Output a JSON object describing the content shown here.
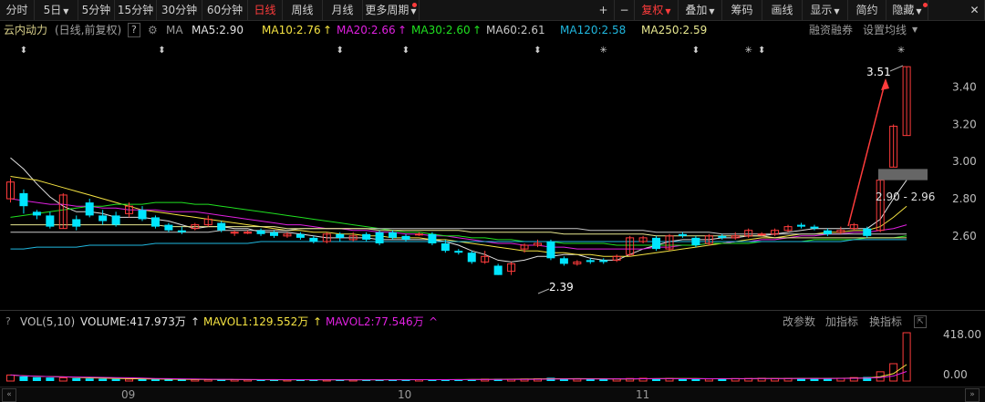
{
  "toolbar": {
    "tabs": [
      {
        "label": "分时"
      },
      {
        "label": "5日",
        "caret": "▼"
      },
      {
        "label": "5分钟"
      },
      {
        "label": "15分钟"
      },
      {
        "label": "30分钟"
      },
      {
        "label": "60分钟"
      },
      {
        "label": "日线",
        "active": true
      },
      {
        "label": "周线"
      },
      {
        "label": "月线"
      },
      {
        "label": "更多周期",
        "caret": "▼"
      }
    ],
    "right": [
      {
        "label": "+"
      },
      {
        "label": "−"
      },
      {
        "label": "复权",
        "caret": "▼",
        "red": true
      },
      {
        "label": "叠加",
        "caret": "▼"
      },
      {
        "label": "筹码"
      },
      {
        "label": "画线"
      },
      {
        "label": "显示",
        "caret": "▼"
      },
      {
        "label": "简约"
      },
      {
        "label": "隐藏",
        "caret": "▼"
      }
    ],
    "close_icon": "close-icon"
  },
  "indicator_line": {
    "stock": "云内动力",
    "mode": "(日线,前复权)",
    "help": "?",
    "ma_label": "MA",
    "ma5": "MA5:2.90",
    "ma10": "MA10:2.76",
    "ma20": "MA20:2.66",
    "ma30": "MA30:2.60",
    "ma60": "MA60:2.61",
    "ma120": "MA120:2.58",
    "ma250": "MA250:2.59",
    "up_arrow": "↑",
    "rzrq": "融资融券",
    "settings": "设置均线",
    "settings_caret": "▼"
  },
  "volume_line": {
    "help": "?",
    "label": "VOL(5,10)",
    "volume": "VOLUME:417.973万",
    "mavol1": "MAVOL1:129.552万",
    "mavol2": "MAVOL2:77.546万",
    "up_arrow": "↑",
    "caret": "^",
    "change_params": "改参数",
    "add_indicator": "加指标",
    "switch_indicator": "换指标"
  },
  "colors": {
    "up": "#ff3c3c",
    "down": "#00e5ff",
    "ma5": "#e0e0e0",
    "ma10": "#f5e342",
    "ma20": "#e020e0",
    "ma30": "#20e020",
    "ma60": "#c8c8c8",
    "ma120": "#20b8e0",
    "ma250": "#e8e890"
  },
  "event_markers": [
    "⬍",
    "⬍",
    "⬍",
    "⬍",
    "⬍",
    "✳",
    "⬍",
    "✳",
    "⬍",
    "✳"
  ],
  "chart_data": {
    "type": "candlestick",
    "ylim": [
      2.31,
      3.55
    ],
    "y_ticks": [
      "3.40",
      "3.20",
      "3.00",
      "2.80",
      "2.60"
    ],
    "x_ticks": [
      "09",
      "10",
      "11"
    ],
    "candles": [
      {
        "o": 2.8,
        "c": 2.89,
        "h": 2.91,
        "l": 2.78
      },
      {
        "o": 2.83,
        "c": 2.76,
        "h": 2.85,
        "l": 2.72
      },
      {
        "o": 2.73,
        "c": 2.71,
        "h": 2.74,
        "l": 2.69
      },
      {
        "o": 2.71,
        "c": 2.65,
        "h": 2.73,
        "l": 2.64
      },
      {
        "o": 2.64,
        "c": 2.82,
        "h": 2.83,
        "l": 2.64
      },
      {
        "o": 2.69,
        "c": 2.65,
        "h": 2.71,
        "l": 2.63
      },
      {
        "o": 2.78,
        "c": 2.71,
        "h": 2.8,
        "l": 2.7
      },
      {
        "o": 2.71,
        "c": 2.68,
        "h": 2.74,
        "l": 2.66
      },
      {
        "o": 2.71,
        "c": 2.66,
        "h": 2.73,
        "l": 2.65
      },
      {
        "o": 2.72,
        "c": 2.76,
        "h": 2.78,
        "l": 2.7
      },
      {
        "o": 2.74,
        "c": 2.69,
        "h": 2.76,
        "l": 2.68
      },
      {
        "o": 2.7,
        "c": 2.65,
        "h": 2.71,
        "l": 2.64
      },
      {
        "o": 2.66,
        "c": 2.63,
        "h": 2.67,
        "l": 2.62
      },
      {
        "o": 2.63,
        "c": 2.62,
        "h": 2.65,
        "l": 2.61
      },
      {
        "o": 2.64,
        "c": 2.66,
        "h": 2.67,
        "l": 2.63
      },
      {
        "o": 2.66,
        "c": 2.69,
        "h": 2.71,
        "l": 2.65
      },
      {
        "o": 2.67,
        "c": 2.63,
        "h": 2.68,
        "l": 2.62
      },
      {
        "o": 2.62,
        "c": 2.62,
        "h": 2.63,
        "l": 2.6
      },
      {
        "o": 2.62,
        "c": 2.62,
        "h": 2.63,
        "l": 2.61
      },
      {
        "o": 2.63,
        "c": 2.61,
        "h": 2.64,
        "l": 2.6
      },
      {
        "o": 2.62,
        "c": 2.6,
        "h": 2.63,
        "l": 2.59
      },
      {
        "o": 2.6,
        "c": 2.61,
        "h": 2.62,
        "l": 2.59
      },
      {
        "o": 2.61,
        "c": 2.59,
        "h": 2.62,
        "l": 2.58
      },
      {
        "o": 2.59,
        "c": 2.57,
        "h": 2.6,
        "l": 2.56
      },
      {
        "o": 2.57,
        "c": 2.61,
        "h": 2.62,
        "l": 2.56
      },
      {
        "o": 2.61,
        "c": 2.59,
        "h": 2.62,
        "l": 2.57
      },
      {
        "o": 2.58,
        "c": 2.6,
        "h": 2.62,
        "l": 2.57
      },
      {
        "o": 2.61,
        "c": 2.58,
        "h": 2.62,
        "l": 2.57
      },
      {
        "o": 2.62,
        "c": 2.56,
        "h": 2.63,
        "l": 2.55
      },
      {
        "o": 2.62,
        "c": 2.59,
        "h": 2.63,
        "l": 2.58
      },
      {
        "o": 2.6,
        "c": 2.58,
        "h": 2.61,
        "l": 2.57
      },
      {
        "o": 2.61,
        "c": 2.61,
        "h": 2.62,
        "l": 2.6
      },
      {
        "o": 2.61,
        "c": 2.56,
        "h": 2.62,
        "l": 2.55
      },
      {
        "o": 2.56,
        "c": 2.52,
        "h": 2.58,
        "l": 2.51
      },
      {
        "o": 2.52,
        "c": 2.51,
        "h": 2.53,
        "l": 2.5
      },
      {
        "o": 2.51,
        "c": 2.46,
        "h": 2.52,
        "l": 2.45
      },
      {
        "o": 2.46,
        "c": 2.49,
        "h": 2.52,
        "l": 2.45
      },
      {
        "o": 2.44,
        "c": 2.39,
        "h": 2.45,
        "l": 2.39
      },
      {
        "o": 2.41,
        "c": 2.45,
        "h": 2.46,
        "l": 2.39
      },
      {
        "o": 2.53,
        "c": 2.55,
        "h": 2.56,
        "l": 2.51
      },
      {
        "o": 2.55,
        "c": 2.56,
        "h": 2.58,
        "l": 2.54
      },
      {
        "o": 2.57,
        "c": 2.48,
        "h": 2.58,
        "l": 2.47
      },
      {
        "o": 2.48,
        "c": 2.45,
        "h": 2.49,
        "l": 2.44
      },
      {
        "o": 2.45,
        "c": 2.46,
        "h": 2.47,
        "l": 2.44
      },
      {
        "o": 2.47,
        "c": 2.46,
        "h": 2.48,
        "l": 2.45
      },
      {
        "o": 2.47,
        "c": 2.46,
        "h": 2.48,
        "l": 2.45
      },
      {
        "o": 2.47,
        "c": 2.49,
        "h": 2.5,
        "l": 2.46
      },
      {
        "o": 2.5,
        "c": 2.59,
        "h": 2.6,
        "l": 2.49
      },
      {
        "o": 2.57,
        "c": 2.59,
        "h": 2.6,
        "l": 2.56
      },
      {
        "o": 2.59,
        "c": 2.53,
        "h": 2.6,
        "l": 2.52
      },
      {
        "o": 2.53,
        "c": 2.6,
        "h": 2.61,
        "l": 2.52
      },
      {
        "o": 2.61,
        "c": 2.6,
        "h": 2.62,
        "l": 2.59
      },
      {
        "o": 2.59,
        "c": 2.55,
        "h": 2.6,
        "l": 2.54
      },
      {
        "o": 2.56,
        "c": 2.6,
        "h": 2.61,
        "l": 2.55
      },
      {
        "o": 2.6,
        "c": 2.59,
        "h": 2.61,
        "l": 2.58
      },
      {
        "o": 2.59,
        "c": 2.6,
        "h": 2.62,
        "l": 2.58
      },
      {
        "o": 2.6,
        "c": 2.63,
        "h": 2.64,
        "l": 2.59
      },
      {
        "o": 2.61,
        "c": 2.61,
        "h": 2.62,
        "l": 2.6
      },
      {
        "o": 2.61,
        "c": 2.63,
        "h": 2.64,
        "l": 2.6
      },
      {
        "o": 2.63,
        "c": 2.65,
        "h": 2.66,
        "l": 2.62
      },
      {
        "o": 2.66,
        "c": 2.65,
        "h": 2.67,
        "l": 2.64
      },
      {
        "o": 2.65,
        "c": 2.64,
        "h": 2.66,
        "l": 2.63
      },
      {
        "o": 2.63,
        "c": 2.61,
        "h": 2.64,
        "l": 2.6
      },
      {
        "o": 2.62,
        "c": 2.63,
        "h": 2.65,
        "l": 2.61
      },
      {
        "o": 2.64,
        "c": 2.66,
        "h": 2.67,
        "l": 2.63
      },
      {
        "o": 2.64,
        "c": 2.6,
        "h": 2.65,
        "l": 2.59
      },
      {
        "o": 2.63,
        "c": 2.9,
        "h": 2.9,
        "l": 2.62
      },
      {
        "o": 2.97,
        "c": 3.19,
        "h": 3.2,
        "l": 2.97
      },
      {
        "o": 3.14,
        "c": 3.51,
        "h": 3.51,
        "l": 3.14
      }
    ],
    "ma_series": [
      {
        "name": "MA5",
        "color_key": "ma5",
        "values": [
          3.02,
          2.96,
          2.88,
          2.81,
          2.76,
          2.73,
          2.73,
          2.72,
          2.7,
          2.7,
          2.7,
          2.69,
          2.68,
          2.66,
          2.64,
          2.65,
          2.65,
          2.64,
          2.64,
          2.62,
          2.62,
          2.62,
          2.61,
          2.6,
          2.59,
          2.59,
          2.59,
          2.59,
          2.58,
          2.58,
          2.58,
          2.58,
          2.58,
          2.57,
          2.55,
          2.52,
          2.5,
          2.47,
          2.46,
          2.47,
          2.49,
          2.49,
          2.5,
          2.5,
          2.48,
          2.47,
          2.47,
          2.5,
          2.53,
          2.55,
          2.57,
          2.58,
          2.58,
          2.58,
          2.59,
          2.59,
          2.6,
          2.6,
          2.61,
          2.62,
          2.63,
          2.64,
          2.64,
          2.64,
          2.64,
          2.64,
          2.69,
          2.8,
          2.9
        ]
      },
      {
        "name": "MA10",
        "color_key": "ma10",
        "values": [
          2.92,
          2.91,
          2.9,
          2.88,
          2.86,
          2.84,
          2.82,
          2.8,
          2.78,
          2.76,
          2.74,
          2.73,
          2.72,
          2.71,
          2.7,
          2.69,
          2.68,
          2.67,
          2.66,
          2.65,
          2.64,
          2.63,
          2.63,
          2.62,
          2.62,
          2.61,
          2.61,
          2.6,
          2.6,
          2.59,
          2.59,
          2.59,
          2.58,
          2.58,
          2.57,
          2.56,
          2.55,
          2.54,
          2.53,
          2.52,
          2.52,
          2.51,
          2.51,
          2.5,
          2.5,
          2.49,
          2.49,
          2.49,
          2.5,
          2.51,
          2.52,
          2.53,
          2.54,
          2.55,
          2.56,
          2.57,
          2.58,
          2.59,
          2.59,
          2.6,
          2.61,
          2.61,
          2.62,
          2.62,
          2.63,
          2.63,
          2.65,
          2.7,
          2.76
        ]
      },
      {
        "name": "MA20",
        "color_key": "ma20",
        "values": [
          2.8,
          2.79,
          2.78,
          2.77,
          2.77,
          2.76,
          2.76,
          2.75,
          2.75,
          2.74,
          2.74,
          2.74,
          2.73,
          2.73,
          2.73,
          2.72,
          2.71,
          2.7,
          2.69,
          2.68,
          2.67,
          2.66,
          2.66,
          2.65,
          2.64,
          2.64,
          2.63,
          2.63,
          2.62,
          2.62,
          2.61,
          2.61,
          2.6,
          2.6,
          2.59,
          2.58,
          2.57,
          2.56,
          2.56,
          2.55,
          2.55,
          2.54,
          2.54,
          2.53,
          2.53,
          2.53,
          2.53,
          2.53,
          2.53,
          2.54,
          2.54,
          2.55,
          2.55,
          2.56,
          2.56,
          2.57,
          2.57,
          2.58,
          2.58,
          2.59,
          2.6,
          2.6,
          2.61,
          2.61,
          2.62,
          2.62,
          2.63,
          2.64,
          2.66
        ]
      },
      {
        "name": "MA30",
        "color_key": "ma30",
        "values": [
          2.7,
          2.71,
          2.72,
          2.73,
          2.74,
          2.75,
          2.76,
          2.76,
          2.77,
          2.77,
          2.77,
          2.78,
          2.78,
          2.78,
          2.77,
          2.77,
          2.76,
          2.75,
          2.74,
          2.73,
          2.72,
          2.71,
          2.7,
          2.69,
          2.68,
          2.67,
          2.66,
          2.65,
          2.64,
          2.63,
          2.62,
          2.62,
          2.61,
          2.6,
          2.6,
          2.59,
          2.59,
          2.58,
          2.58,
          2.57,
          2.57,
          2.57,
          2.56,
          2.56,
          2.56,
          2.56,
          2.55,
          2.55,
          2.55,
          2.55,
          2.55,
          2.55,
          2.55,
          2.56,
          2.56,
          2.56,
          2.56,
          2.57,
          2.57,
          2.57,
          2.57,
          2.58,
          2.58,
          2.58,
          2.58,
          2.59,
          2.59,
          2.59,
          2.6
        ]
      },
      {
        "name": "MA60",
        "color_key": "ma60",
        "values": [
          2.62,
          2.62,
          2.62,
          2.62,
          2.62,
          2.62,
          2.62,
          2.62,
          2.62,
          2.62,
          2.62,
          2.62,
          2.62,
          2.62,
          2.62,
          2.62,
          2.63,
          2.63,
          2.63,
          2.63,
          2.63,
          2.63,
          2.64,
          2.64,
          2.64,
          2.64,
          2.64,
          2.64,
          2.64,
          2.64,
          2.64,
          2.64,
          2.64,
          2.64,
          2.64,
          2.64,
          2.64,
          2.64,
          2.64,
          2.64,
          2.64,
          2.64,
          2.64,
          2.64,
          2.63,
          2.63,
          2.63,
          2.63,
          2.63,
          2.62,
          2.62,
          2.62,
          2.62,
          2.62,
          2.61,
          2.61,
          2.61,
          2.61,
          2.61,
          2.61,
          2.61,
          2.61,
          2.61,
          2.61,
          2.61,
          2.61,
          2.61,
          2.61,
          2.61
        ]
      },
      {
        "name": "MA120",
        "color_key": "ma120",
        "values": [
          2.53,
          2.53,
          2.54,
          2.54,
          2.54,
          2.54,
          2.55,
          2.55,
          2.55,
          2.55,
          2.55,
          2.56,
          2.56,
          2.56,
          2.56,
          2.56,
          2.56,
          2.56,
          2.56,
          2.57,
          2.57,
          2.57,
          2.57,
          2.57,
          2.57,
          2.57,
          2.57,
          2.57,
          2.57,
          2.57,
          2.57,
          2.57,
          2.57,
          2.57,
          2.57,
          2.57,
          2.57,
          2.57,
          2.57,
          2.57,
          2.57,
          2.57,
          2.57,
          2.57,
          2.57,
          2.57,
          2.57,
          2.57,
          2.57,
          2.57,
          2.57,
          2.57,
          2.57,
          2.57,
          2.57,
          2.57,
          2.57,
          2.57,
          2.57,
          2.57,
          2.57,
          2.57,
          2.57,
          2.57,
          2.58,
          2.58,
          2.58,
          2.58,
          2.58
        ]
      },
      {
        "name": "MA250",
        "color_key": "ma250",
        "values": [
          2.66,
          2.66,
          2.66,
          2.66,
          2.66,
          2.66,
          2.66,
          2.66,
          2.66,
          2.66,
          2.66,
          2.66,
          2.65,
          2.65,
          2.65,
          2.65,
          2.65,
          2.65,
          2.65,
          2.65,
          2.65,
          2.64,
          2.64,
          2.64,
          2.64,
          2.64,
          2.64,
          2.64,
          2.63,
          2.63,
          2.63,
          2.63,
          2.63,
          2.63,
          2.63,
          2.62,
          2.62,
          2.62,
          2.62,
          2.62,
          2.62,
          2.62,
          2.61,
          2.61,
          2.61,
          2.61,
          2.61,
          2.61,
          2.61,
          2.6,
          2.6,
          2.6,
          2.6,
          2.6,
          2.6,
          2.6,
          2.6,
          2.6,
          2.59,
          2.59,
          2.59,
          2.59,
          2.59,
          2.59,
          2.59,
          2.59,
          2.59,
          2.59,
          2.59
        ]
      }
    ],
    "volume": {
      "y_ticks": [
        "418.00",
        "0.00"
      ],
      "ylim": [
        0,
        418
      ],
      "values": [
        52,
        40,
        33,
        30,
        28,
        25,
        22,
        20,
        18,
        17,
        16,
        15,
        14,
        13,
        13,
        12,
        12,
        12,
        11,
        11,
        11,
        11,
        11,
        11,
        11,
        12,
        12,
        11,
        11,
        12,
        12,
        12,
        12,
        13,
        14,
        15,
        16,
        18,
        15,
        17,
        19,
        28,
        20,
        17,
        16,
        18,
        19,
        22,
        24,
        20,
        22,
        21,
        19,
        18,
        20,
        21,
        22,
        24,
        21,
        22,
        24,
        25,
        22,
        24,
        30,
        35,
        80,
        150,
        418
      ]
    },
    "annotations": {
      "high_label": "3.51",
      "low_label": "2.39",
      "current_range": "2.90 - 2.96"
    }
  }
}
